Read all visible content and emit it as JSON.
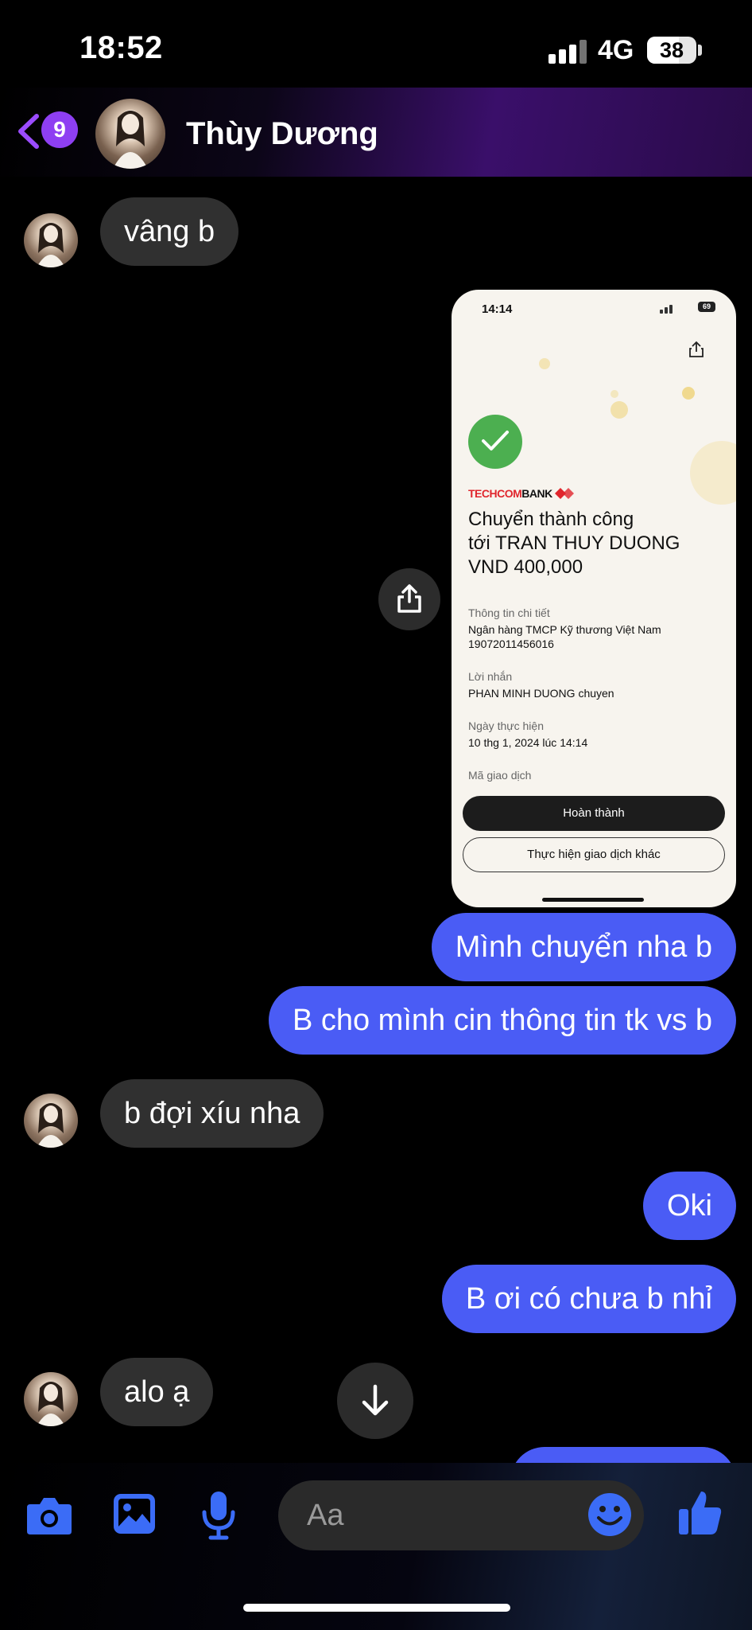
{
  "status": {
    "time": "18:52",
    "network": "4G",
    "battery": "38"
  },
  "header": {
    "unread_count": "9",
    "contact_name": "Thùy Dương"
  },
  "messages": {
    "m1": "vâng b",
    "m2": "Mình chuyển nha b",
    "m3": "B cho mình cin thông tin tk vs b",
    "m4": "b đợi xíu nha",
    "m5": "Oki",
    "m6": "B ơi có chưa b nhỉ",
    "m7": "alo ạ"
  },
  "receipt": {
    "time": "14:14",
    "battery": "69",
    "bank_brand_red": "TECHCOM",
    "bank_brand_dark": "BANK",
    "title_line1": "Chuyển thành công",
    "title_line2": "tới TRAN THUY DUONG",
    "title_line3": "VND 400,000",
    "detail_label": "Thông tin chi tiết",
    "detail_bank": "Ngân hàng TMCP Kỹ thương Việt Nam",
    "detail_account": "19072011456016",
    "message_label": "Lời nhắn",
    "message_value": "PHAN MINH DUONG chuyen",
    "date_label": "Ngày thực hiện",
    "date_value": "10 thg 1, 2024 lúc 14:14",
    "txn_label": "Mã giao dịch",
    "done_button": "Hoàn thành",
    "other_button": "Thực hiện giao dịch khác"
  },
  "composer": {
    "placeholder": "Aa"
  },
  "colors": {
    "outgoing_bubble": "#4a5cf5",
    "incoming_bubble": "#303030",
    "accent": "#8e3ff2",
    "icon_blue": "#3b6cf6"
  },
  "icons": [
    "back-icon",
    "camera-icon",
    "image-icon",
    "microphone-icon",
    "emoji-icon",
    "thumbs-up-icon",
    "share-icon",
    "arrow-down-icon"
  ]
}
